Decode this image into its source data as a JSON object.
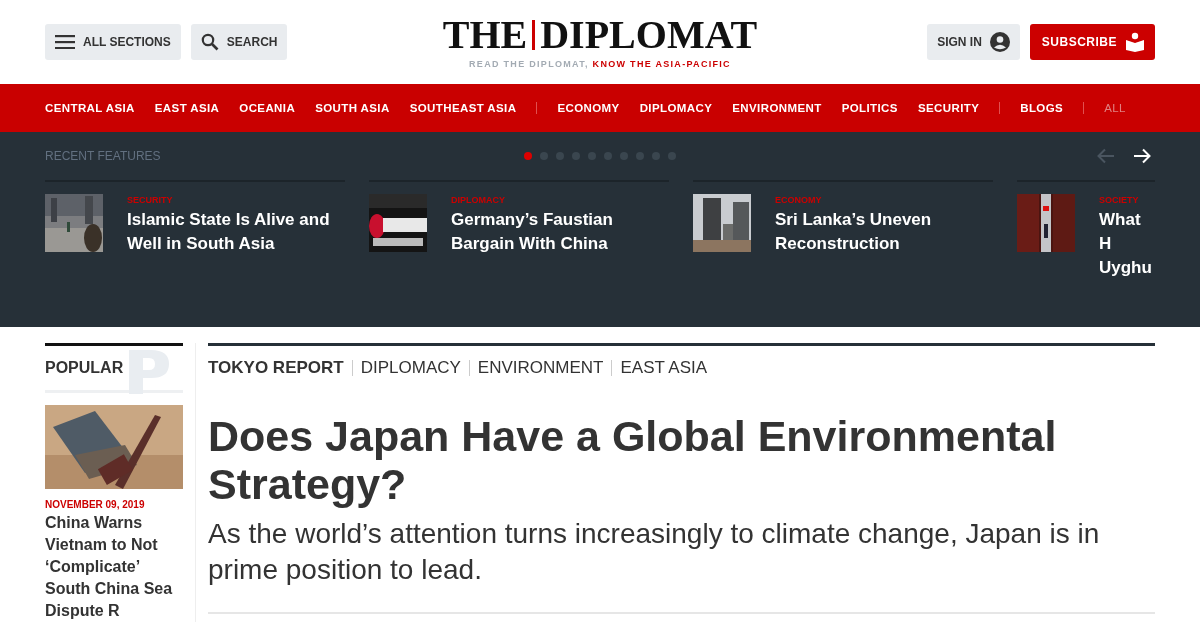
{
  "header": {
    "menu_button": "ALL SECTIONS",
    "search_button": "SEARCH",
    "logo": {
      "left": "THE",
      "right": "DIPLOMAT"
    },
    "tagline": {
      "muted": "READ THE DIPLOMAT,",
      "accent": "KNOW THE ASIA-PACIFIC"
    },
    "sign_in": "SIGN IN",
    "subscribe": "SUBSCRIBE"
  },
  "nav": [
    {
      "items": [
        {
          "label": "CENTRAL ASIA",
          "muted": false
        },
        {
          "label": "EAST ASIA",
          "muted": false
        },
        {
          "label": "OCEANIA",
          "muted": false
        },
        {
          "label": "SOUTH ASIA",
          "muted": false
        },
        {
          "label": "SOUTHEAST ASIA",
          "muted": false
        }
      ]
    },
    {
      "items": [
        {
          "label": "ECONOMY",
          "muted": false
        },
        {
          "label": "DIPLOMACY",
          "muted": false
        },
        {
          "label": "ENVIRONMENT",
          "muted": false
        },
        {
          "label": "POLITICS",
          "muted": false
        },
        {
          "label": "SECURITY",
          "muted": false
        }
      ]
    },
    {
      "items": [
        {
          "label": "BLOGS",
          "muted": false
        }
      ]
    },
    {
      "items": [
        {
          "label": "ALL",
          "muted": true
        }
      ]
    }
  ],
  "features": {
    "heading": "RECENT FEATURES",
    "dots": [
      {
        "selected": true
      },
      {
        "selected": false
      },
      {
        "selected": false
      },
      {
        "selected": false
      },
      {
        "selected": false
      },
      {
        "selected": false
      },
      {
        "selected": false
      },
      {
        "selected": false
      },
      {
        "selected": false
      },
      {
        "selected": false
      }
    ],
    "prev_disabled": true,
    "next_disabled": false,
    "cards": [
      {
        "tag": "SECURITY",
        "title": "Islamic State Is Alive and Well in South Asia",
        "kind": "street"
      },
      {
        "tag": "DIPLOMACY",
        "title": "Germany’s Faustian Bargain With China",
        "kind": "sign"
      },
      {
        "tag": "ECONOMY",
        "title": "Sri Lanka’s Uneven Reconstruction",
        "kind": "tower"
      },
      {
        "tag": "SOCIETY",
        "title": "What H Uyghu",
        "kind": "gate"
      }
    ]
  },
  "popular": {
    "heading": "POPULAR",
    "date": "NOVEMBER 09, 2019",
    "title": "China Warns Vietnam to Not ‘Complicate’ South China Sea Dispute R"
  },
  "article": {
    "categories": [
      "TOKYO REPORT",
      "DIPLOMACY",
      "ENVIRONMENT",
      "EAST ASIA"
    ],
    "title": "Does Japan Have a Global Environmental Strategy?",
    "subtitle": "As the world’s attention turns increasingly to climate change, Japan is in prime position to lead."
  }
}
